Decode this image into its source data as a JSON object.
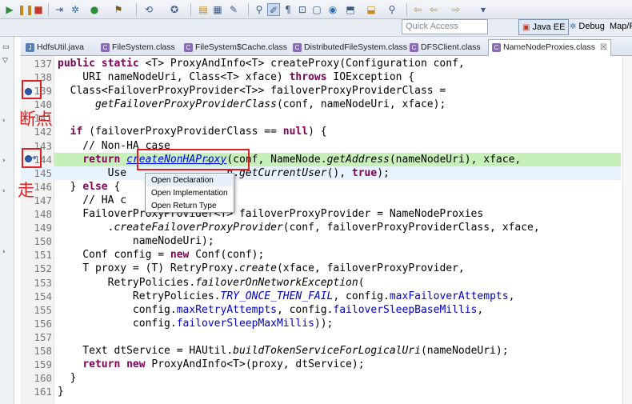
{
  "toolbar": {
    "icons": [
      "run-icon",
      "suspend-icon",
      "terminate-icon",
      "step-icon",
      "debug-icon",
      "run-menu-icon",
      "external-tools-icon",
      "new-icon",
      "open-type-icon",
      "search-icon",
      "toggle-mark-icon",
      "open-folder-icon",
      "refresh-icon",
      "prev-annotation-icon",
      "next-annotation-icon",
      "back-icon",
      "forward-icon",
      "pin-icon"
    ]
  },
  "quick_access": {
    "placeholder": "Quick Access"
  },
  "perspectives": [
    {
      "label": "Java EE",
      "active": true
    },
    {
      "label": "Debug",
      "active": false
    },
    {
      "label": "Map/R",
      "active": false
    }
  ],
  "tabs": [
    {
      "label": "HdfsUtil.java",
      "active": false
    },
    {
      "label": "FileSystem.class",
      "active": false
    },
    {
      "label": "FileSystem$Cache.class",
      "active": false
    },
    {
      "label": "DistributedFileSystem.class",
      "active": false
    },
    {
      "label": "DFSClient.class",
      "active": false
    },
    {
      "label": "NameNodeProxies.class",
      "active": true,
      "close": "☒"
    }
  ],
  "editor": {
    "lines": [
      {
        "n": "137"
      },
      {
        "n": "138"
      },
      {
        "n": "139"
      },
      {
        "n": "140"
      },
      {
        "n": "141"
      },
      {
        "n": "142"
      },
      {
        "n": "143"
      },
      {
        "n": "144"
      },
      {
        "n": "145"
      },
      {
        "n": "146"
      },
      {
        "n": "147"
      },
      {
        "n": "148"
      },
      {
        "n": "149"
      },
      {
        "n": "150"
      },
      {
        "n": "151"
      },
      {
        "n": "152"
      },
      {
        "n": "153"
      },
      {
        "n": "154"
      },
      {
        "n": "155"
      },
      {
        "n": "156"
      },
      {
        "n": "157"
      },
      {
        "n": "158"
      },
      {
        "n": "159"
      },
      {
        "n": "160"
      },
      {
        "n": "161"
      }
    ],
    "code": {
      "l137_a": "public static ",
      "l137_b": "<T> ProxyAndInfo<T> createProxy(Configuration conf,",
      "l138_a": "    URI nameNodeUri, Class<T> xface) ",
      "l138_b": "throws",
      "l138_c": " IOException {",
      "l139": "  Class<FailoverProxyProvider<T>> failoverProxyProviderClass =",
      "l140_a": "      ",
      "l140_b": "getFailoverProxyProviderClass",
      "l140_c": "(conf, nameNodeUri, xface);",
      "l142_a": "  ",
      "l142_b": "if",
      "l142_c": " (failoverProxyProviderClass == ",
      "l142_d": "null",
      "l142_e": ") {",
      "l143": "    // Non-HA case",
      "l144_a": "    ",
      "l144_b": "return",
      "l144_c": " ",
      "l144_d": "createNonHAProxy",
      "l144_e": "(conf, NameNode.",
      "l144_f": "getAddress",
      "l144_g": "(nameNodeUri), xface,",
      "l145_a": "        Use",
      "l145_b": "                ",
      "l145_c": "n.",
      "l145_d": "getCurrentUser",
      "l145_e": "(), ",
      "l145_f": "true",
      "l145_g": ");",
      "l146_a": "  } ",
      "l146_b": "else",
      "l146_c": " {",
      "l147": "    // HA c",
      "l148": "    FailoverProxyProvider<T> failoverProxyProvider = NameNodeProxies",
      "l149_a": "        .",
      "l149_b": "createFailoverProxyProvider",
      "l149_c": "(conf, failoverProxyProviderClass, xface,",
      "l150": "            nameNodeUri);",
      "l151_a": "    Conf config = ",
      "l151_b": "new",
      "l151_c": " Conf(conf);",
      "l152_a": "    T proxy = (T) RetryProxy.",
      "l152_b": "create",
      "l152_c": "(xface, failoverProxyProvider,",
      "l153_a": "        RetryPolicies.",
      "l153_b": "failoverOnNetworkException",
      "l153_c": "(",
      "l154_a": "            RetryPolicies.",
      "l154_b": "TRY_ONCE_THEN_FAIL",
      "l154_c": ", config.",
      "l154_d": "maxFailoverAttempts",
      "l154_e": ",",
      "l155_a": "            config.",
      "l155_b": "maxRetryAttempts",
      "l155_c": ", config.",
      "l155_d": "failoverSleepBaseMillis",
      "l155_e": ",",
      "l156_a": "            config.",
      "l156_b": "failoverSleepMaxMillis",
      "l156_c": "));",
      "l158_a": "    Text dtService = HAUtil.",
      "l158_b": "buildTokenServiceForLogicalUri",
      "l158_c": "(nameNodeUri);",
      "l159_a": "    ",
      "l159_b": "return",
      "l159_c": " ",
      "l159_d": "new",
      "l159_e": " ProxyAndInfo<T>(proxy, dtService);",
      "l160": "  }",
      "l161": "}"
    }
  },
  "context_menu": {
    "items": [
      "Open Declaration",
      "Open Implementation",
      "Open Return Type"
    ]
  },
  "annotations": {
    "breakpoint_label": "断点",
    "step_label": "走"
  },
  "colors": {
    "annotation_red": "#e02020",
    "current_line_green": "#c6f0b8",
    "keyword": "#7f0055",
    "comment": "#3f7f5f",
    "field": "#0000c0"
  }
}
